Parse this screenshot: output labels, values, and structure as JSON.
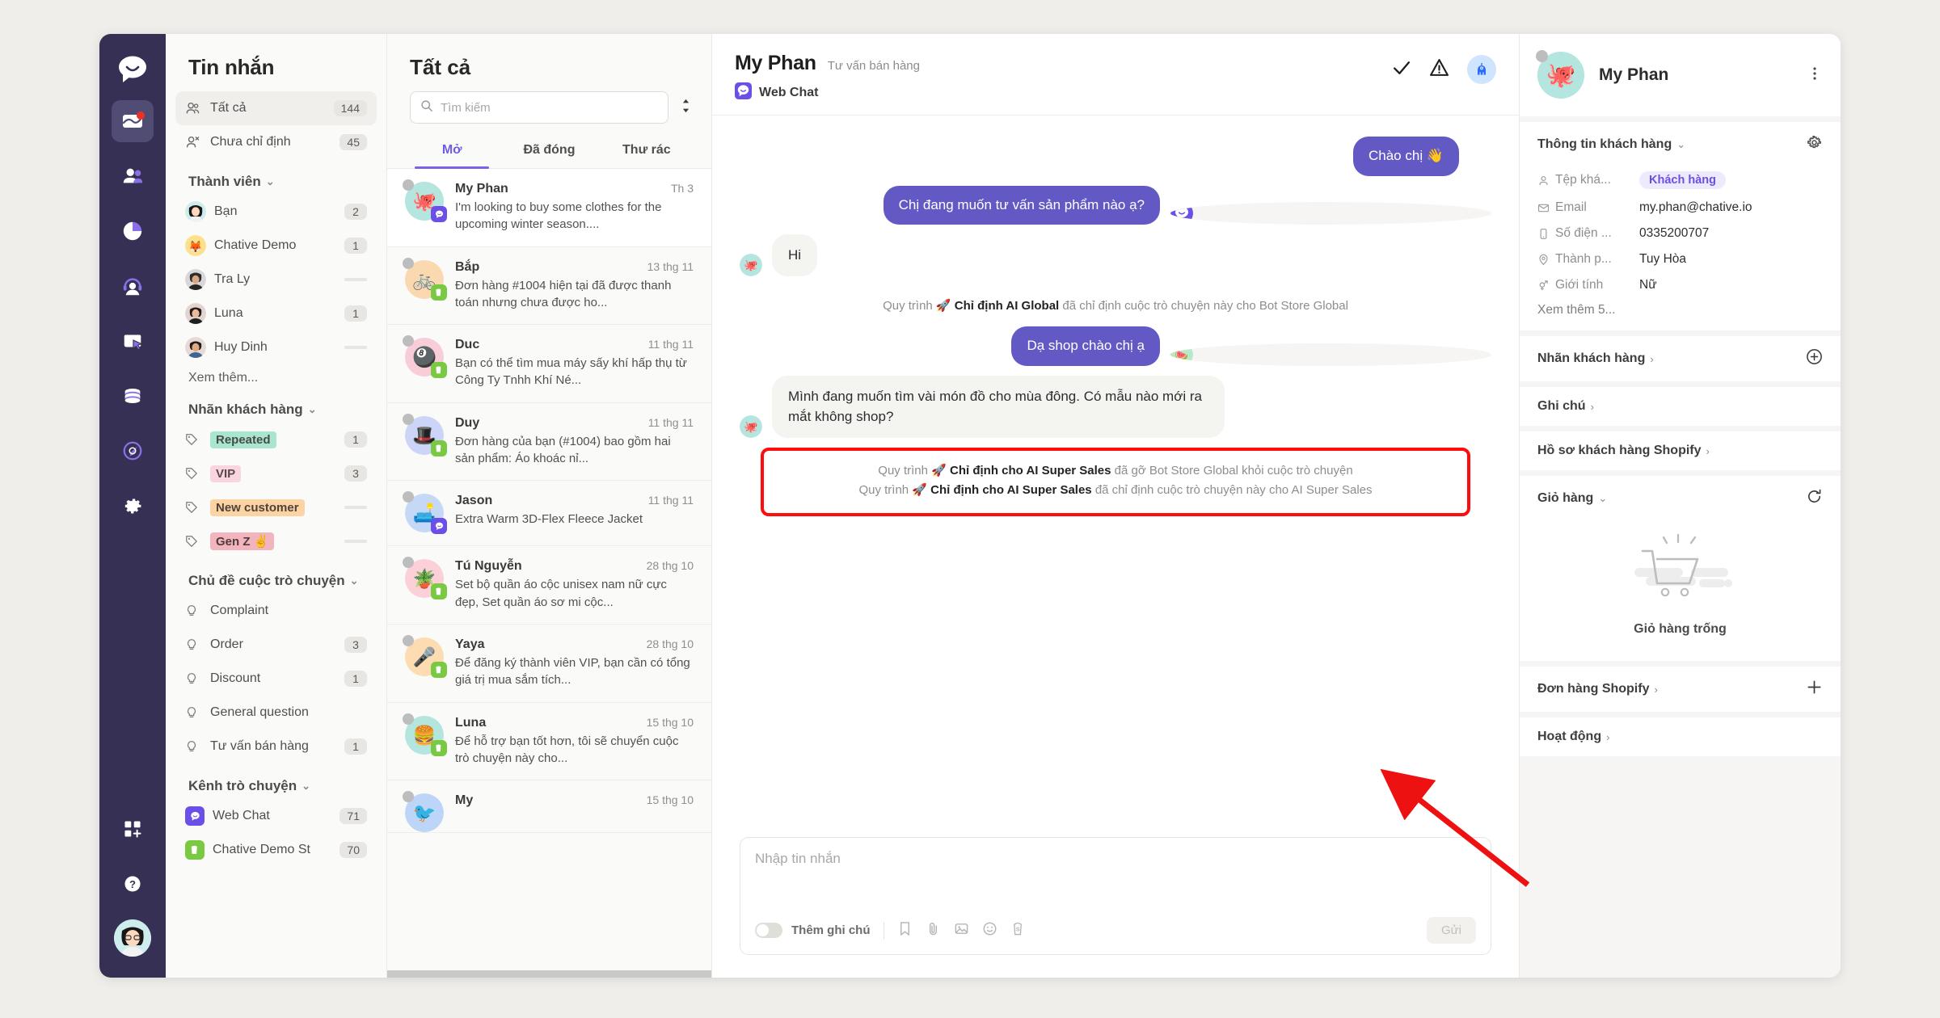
{
  "rail": {
    "items": [
      {
        "name": "logo",
        "icon": "chative-logo-icon"
      },
      {
        "name": "inbox",
        "icon": "inbox-icon",
        "active": true,
        "badge": true
      },
      {
        "name": "contacts",
        "icon": "people-icon"
      },
      {
        "name": "reports",
        "icon": "pie-chart-icon"
      },
      {
        "name": "agents",
        "icon": "headset-icon"
      },
      {
        "name": "widgets",
        "icon": "window-cursor-icon"
      },
      {
        "name": "data",
        "icon": "database-icon"
      },
      {
        "name": "automation",
        "icon": "rocket-target-icon"
      },
      {
        "name": "settings",
        "icon": "gear-icon"
      }
    ],
    "apps_icon": "apps-add-icon",
    "help_icon": "question-circle-icon",
    "avatar_icon": "user-avatar"
  },
  "sidebar": {
    "title": "Tin nhắn",
    "filters": [
      {
        "label": "Tất cả",
        "count": "144",
        "icon": "people-icon",
        "selected": true
      },
      {
        "label": "Chưa chỉ định",
        "count": "45",
        "icon": "person-x-icon",
        "selected": false
      }
    ],
    "members_head": "Thành viên",
    "members": [
      {
        "label": "Bạn",
        "count": "2"
      },
      {
        "label": "Chative Demo",
        "count": "1"
      },
      {
        "label": "Tra Ly",
        "count": ""
      },
      {
        "label": "Luna",
        "count": "1"
      },
      {
        "label": "Huy Dinh",
        "count": ""
      }
    ],
    "members_more": "Xem thêm...",
    "tags_head": "Nhãn khách hàng",
    "tags": [
      {
        "label": "Repeated",
        "count": "1",
        "bg": "#a8e6ce",
        "fg": "#4a4a4a"
      },
      {
        "label": "VIP",
        "count": "3",
        "bg": "#f9d5dd",
        "fg": "#5a4a4f"
      },
      {
        "label": "New customer",
        "count": "",
        "bg": "#fcd4a4",
        "fg": "#4f4238"
      },
      {
        "label": "Gen Z ✌️",
        "count": "",
        "bg": "#f3b5bd",
        "fg": "#4f3a3d"
      }
    ],
    "topics_head": "Chủ đề cuộc trò chuyện",
    "topics": [
      {
        "label": "Complaint",
        "count": ""
      },
      {
        "label": "Order",
        "count": "3"
      },
      {
        "label": "Discount",
        "count": "1"
      },
      {
        "label": "General question",
        "count": ""
      },
      {
        "label": "Tư vấn bán hàng",
        "count": "1"
      }
    ],
    "channels_head": "Kênh trò chuyện",
    "channels": [
      {
        "label": "Web Chat",
        "count": "71",
        "color": "#6c4ee8"
      },
      {
        "label": "Chative Demo St",
        "count": "70",
        "color": "#7ac943"
      }
    ]
  },
  "convlist": {
    "title": "Tất cả",
    "search_placeholder": "Tìm kiếm",
    "sort_icon": "sort-icon",
    "tabs": [
      {
        "label": "Mở",
        "active": true
      },
      {
        "label": "Đã đóng",
        "active": false
      },
      {
        "label": "Thư rác",
        "active": false
      }
    ],
    "items": [
      {
        "name": "My Phan",
        "time": "Th 3",
        "preview": "I'm looking to buy some clothes for the upcoming winter season....",
        "avatar_bg": "#b4e5df",
        "emoji": "🐙",
        "channel": "webchat",
        "active": true
      },
      {
        "name": "Bắp",
        "time": "13 thg 11",
        "preview": "Đơn hàng #1004 hiện tại đã được thanh toán nhưng chưa được ho...",
        "avatar_bg": "#fbd9b0",
        "emoji": "🚲",
        "channel": "shopify",
        "active": false
      },
      {
        "name": "Duc",
        "time": "11 thg 11",
        "preview": "Bạn có thể tìm mua máy sấy khí hấp thụ từ Công Ty Tnhh Khí Né...",
        "avatar_bg": "#f9cdd8",
        "emoji": "🎱",
        "channel": "shopify",
        "active": false
      },
      {
        "name": "Duy",
        "time": "11 thg 11",
        "preview": "Đơn hàng của bạn (#1004) bao gồm hai sản phẩm: Áo khoác nỉ...",
        "avatar_bg": "#ccd4f7",
        "emoji": "🎩",
        "channel": "shopify",
        "active": false
      },
      {
        "name": "Jason",
        "time": "11 thg 11",
        "preview": "Extra Warm 3D-Flex Fleece Jacket",
        "avatar_bg": "#c5d9f7",
        "emoji": "🛋️",
        "channel": "webchat",
        "active": false
      },
      {
        "name": "Tú Nguyễn",
        "time": "28 thg 10",
        "preview": "Set bộ quần áo cộc unisex nam nữ cực đẹp, Set quần áo sơ mi cộc...",
        "avatar_bg": "#fbd0d8",
        "emoji": "🪴",
        "channel": "shopify",
        "active": false
      },
      {
        "name": "Yaya",
        "time": "28 thg 10",
        "preview": "Để đăng ký thành viên VIP, bạn cần có tổng giá trị mua sắm tích...",
        "avatar_bg": "#fcdcb0",
        "emoji": "🎤",
        "channel": "shopify",
        "active": false
      },
      {
        "name": "Luna",
        "time": "15 thg 10",
        "preview": "Để hỗ trợ bạn tốt hơn, tôi sẽ chuyển cuộc trò chuyện này cho...",
        "avatar_bg": "#b4e5df",
        "emoji": "🍔",
        "channel": "shopify",
        "active": false
      },
      {
        "name": "My",
        "time": "15 thg 10",
        "preview": "",
        "avatar_bg": "#bcd5f8",
        "emoji": "🐦",
        "channel": "",
        "active": false
      }
    ]
  },
  "chat": {
    "name": "My Phan",
    "topic": "Tư vấn bán hàng",
    "channel": "Web Chat",
    "actions": [
      {
        "name": "resolve-check",
        "icon": "check-icon"
      },
      {
        "name": "report-spam",
        "icon": "warning-triangle-icon"
      },
      {
        "name": "ai-bot",
        "icon": "bot-icon"
      }
    ],
    "messages": [
      {
        "type": "out",
        "text": "Chào chị 👋",
        "avatar": false
      },
      {
        "type": "out",
        "text": "Chị đang muốn tư vấn sản phẩm nào ạ?",
        "avatar": true,
        "avatar_kind": "webchat"
      },
      {
        "type": "in",
        "text": "Hi",
        "avatar": true,
        "avatar_bg": "#b4e5df",
        "emoji": "🐙"
      },
      {
        "type": "system",
        "pre": "Quy trình 🚀 ",
        "bold": "Chỉ định AI Global",
        "post": " đã chỉ định cuộc trò chuyện này cho Bot Store Global"
      },
      {
        "type": "out",
        "text": "Dạ shop chào chị ạ",
        "avatar": true,
        "avatar_bg": "#b9e8c8",
        "emoji": "🍉"
      },
      {
        "type": "in",
        "text": "Mình đang muốn tìm vài món đồ cho mùa đông. Có mẫu nào mới ra mắt không shop?",
        "avatar": true,
        "avatar_bg": "#b4e5df",
        "emoji": "🐙"
      }
    ],
    "highlighted_system": [
      {
        "pre": "Quy trình 🚀 ",
        "bold": "Chỉ định cho AI Super Sales",
        "post": " đã gỡ Bot Store Global khỏi cuộc trò chuyện"
      },
      {
        "pre": "Quy trình 🚀 ",
        "bold": "Chỉ định cho AI Super Sales",
        "post": " đã chỉ định cuộc trò chuyện này cho AI Super Sales"
      }
    ],
    "composer": {
      "placeholder": "Nhập tin nhắn",
      "note_toggle_label": "Thêm ghi chú",
      "icons": [
        "bookmark-icon",
        "paperclip-icon",
        "image-icon",
        "emoji-icon",
        "shopify-icon"
      ],
      "send_label": "Gửi"
    }
  },
  "right_panel": {
    "name": "My Phan",
    "menu_icon": "kebab-menu-icon",
    "info_head": "Thông tin khách hàng",
    "settings_icon": "gear-icon",
    "fields": [
      {
        "icon": "person-icon",
        "key": "Tệp khá...",
        "value": "Khách hàng",
        "chip": true
      },
      {
        "icon": "mail-icon",
        "key": "Email",
        "value": "my.phan@chative.io",
        "chip": false
      },
      {
        "icon": "phone-icon",
        "key": "Số điện ...",
        "value": "0335200707",
        "chip": false
      },
      {
        "icon": "location-icon",
        "key": "Thành p...",
        "value": "Tuy Hòa",
        "chip": false
      },
      {
        "icon": "gender-icon",
        "key": "Giới tính",
        "value": "Nữ",
        "chip": false
      }
    ],
    "see_more": "Xem thêm 5...",
    "sections": [
      {
        "label": "Nhãn khách hàng",
        "marker": "›",
        "action": "plus-circle-icon"
      },
      {
        "label": "Ghi chú",
        "marker": "›",
        "action": ""
      },
      {
        "label": "Hồ sơ khách hàng Shopify",
        "marker": "›",
        "action": ""
      },
      {
        "label": "Giỏ hàng",
        "marker": "⌄",
        "action": "refresh-icon"
      }
    ],
    "cart_empty_label": "Giỏ hàng trống",
    "cart_empty_icon": "empty-cart-icon",
    "bottom_sections": [
      {
        "label": "Đơn hàng Shopify",
        "marker": "›",
        "action": "plus-icon"
      },
      {
        "label": "Hoạt động",
        "marker": "›",
        "action": ""
      }
    ]
  },
  "annotation": {
    "box_color": "#fd0d0d",
    "arrow_color": "#ee1111"
  }
}
